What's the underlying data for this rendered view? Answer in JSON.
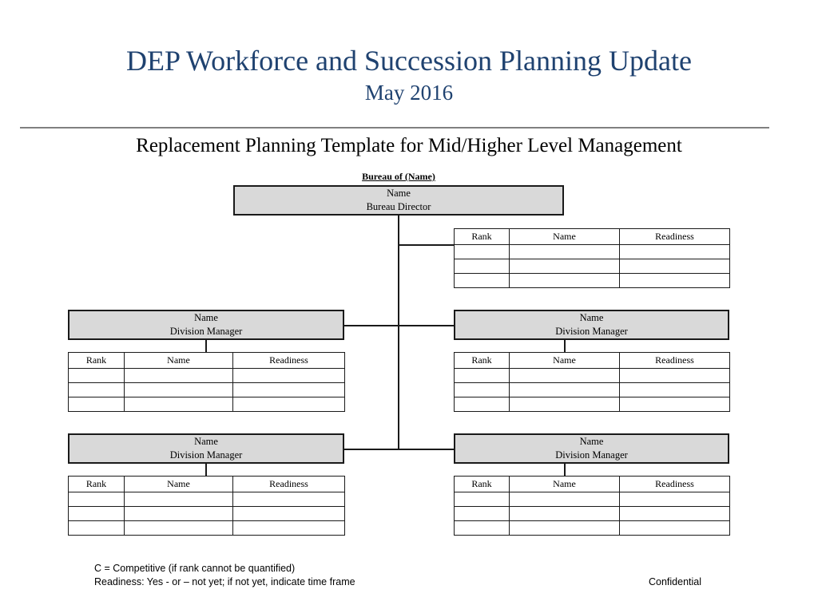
{
  "header": {
    "title": "DEP Workforce and Succession Planning Update",
    "subtitle": "May 2016",
    "section_title": "Replacement Planning Template for Mid/Higher Level Management"
  },
  "chart": {
    "bureau_label": "Bureau of (Name)",
    "root": {
      "name_line": "Name",
      "role_line": "Bureau Director"
    },
    "division_boxes": [
      {
        "name_line": "Name",
        "role_line": "Division Manager"
      },
      {
        "name_line": "Name",
        "role_line": "Division Manager"
      },
      {
        "name_line": "Name",
        "role_line": "Division Manager"
      },
      {
        "name_line": "Name",
        "role_line": "Division Manager"
      }
    ],
    "table_headers": [
      "Rank",
      "Name",
      "Readiness"
    ],
    "table_blank_rows": 3,
    "tables": [
      {
        "id": "root-table",
        "rows": [
          [
            "",
            "",
            ""
          ],
          [
            "",
            "",
            ""
          ],
          [
            "",
            "",
            ""
          ]
        ]
      },
      {
        "id": "div1-table",
        "rows": [
          [
            "",
            "",
            ""
          ],
          [
            "",
            "",
            ""
          ],
          [
            "",
            "",
            ""
          ]
        ]
      },
      {
        "id": "div2-table",
        "rows": [
          [
            "",
            "",
            ""
          ],
          [
            "",
            "",
            ""
          ],
          [
            "",
            "",
            ""
          ]
        ]
      },
      {
        "id": "div3-table",
        "rows": [
          [
            "",
            "",
            ""
          ],
          [
            "",
            "",
            ""
          ],
          [
            "",
            "",
            ""
          ]
        ]
      },
      {
        "id": "div4-table",
        "rows": [
          [
            "",
            "",
            ""
          ],
          [
            "",
            "",
            ""
          ],
          [
            "",
            "",
            ""
          ]
        ]
      }
    ]
  },
  "footer": {
    "legend_line_1": "C = Competitive (if rank cannot be quantified)",
    "legend_line_2": "Readiness:  Yes - or – not yet; if not yet, indicate time frame",
    "classification": "Confidential"
  },
  "colors": {
    "title_blue": "#1F4270",
    "box_fill": "#D9D9D9",
    "line_black": "#1A1A1A",
    "rule_gray": "#808080"
  }
}
